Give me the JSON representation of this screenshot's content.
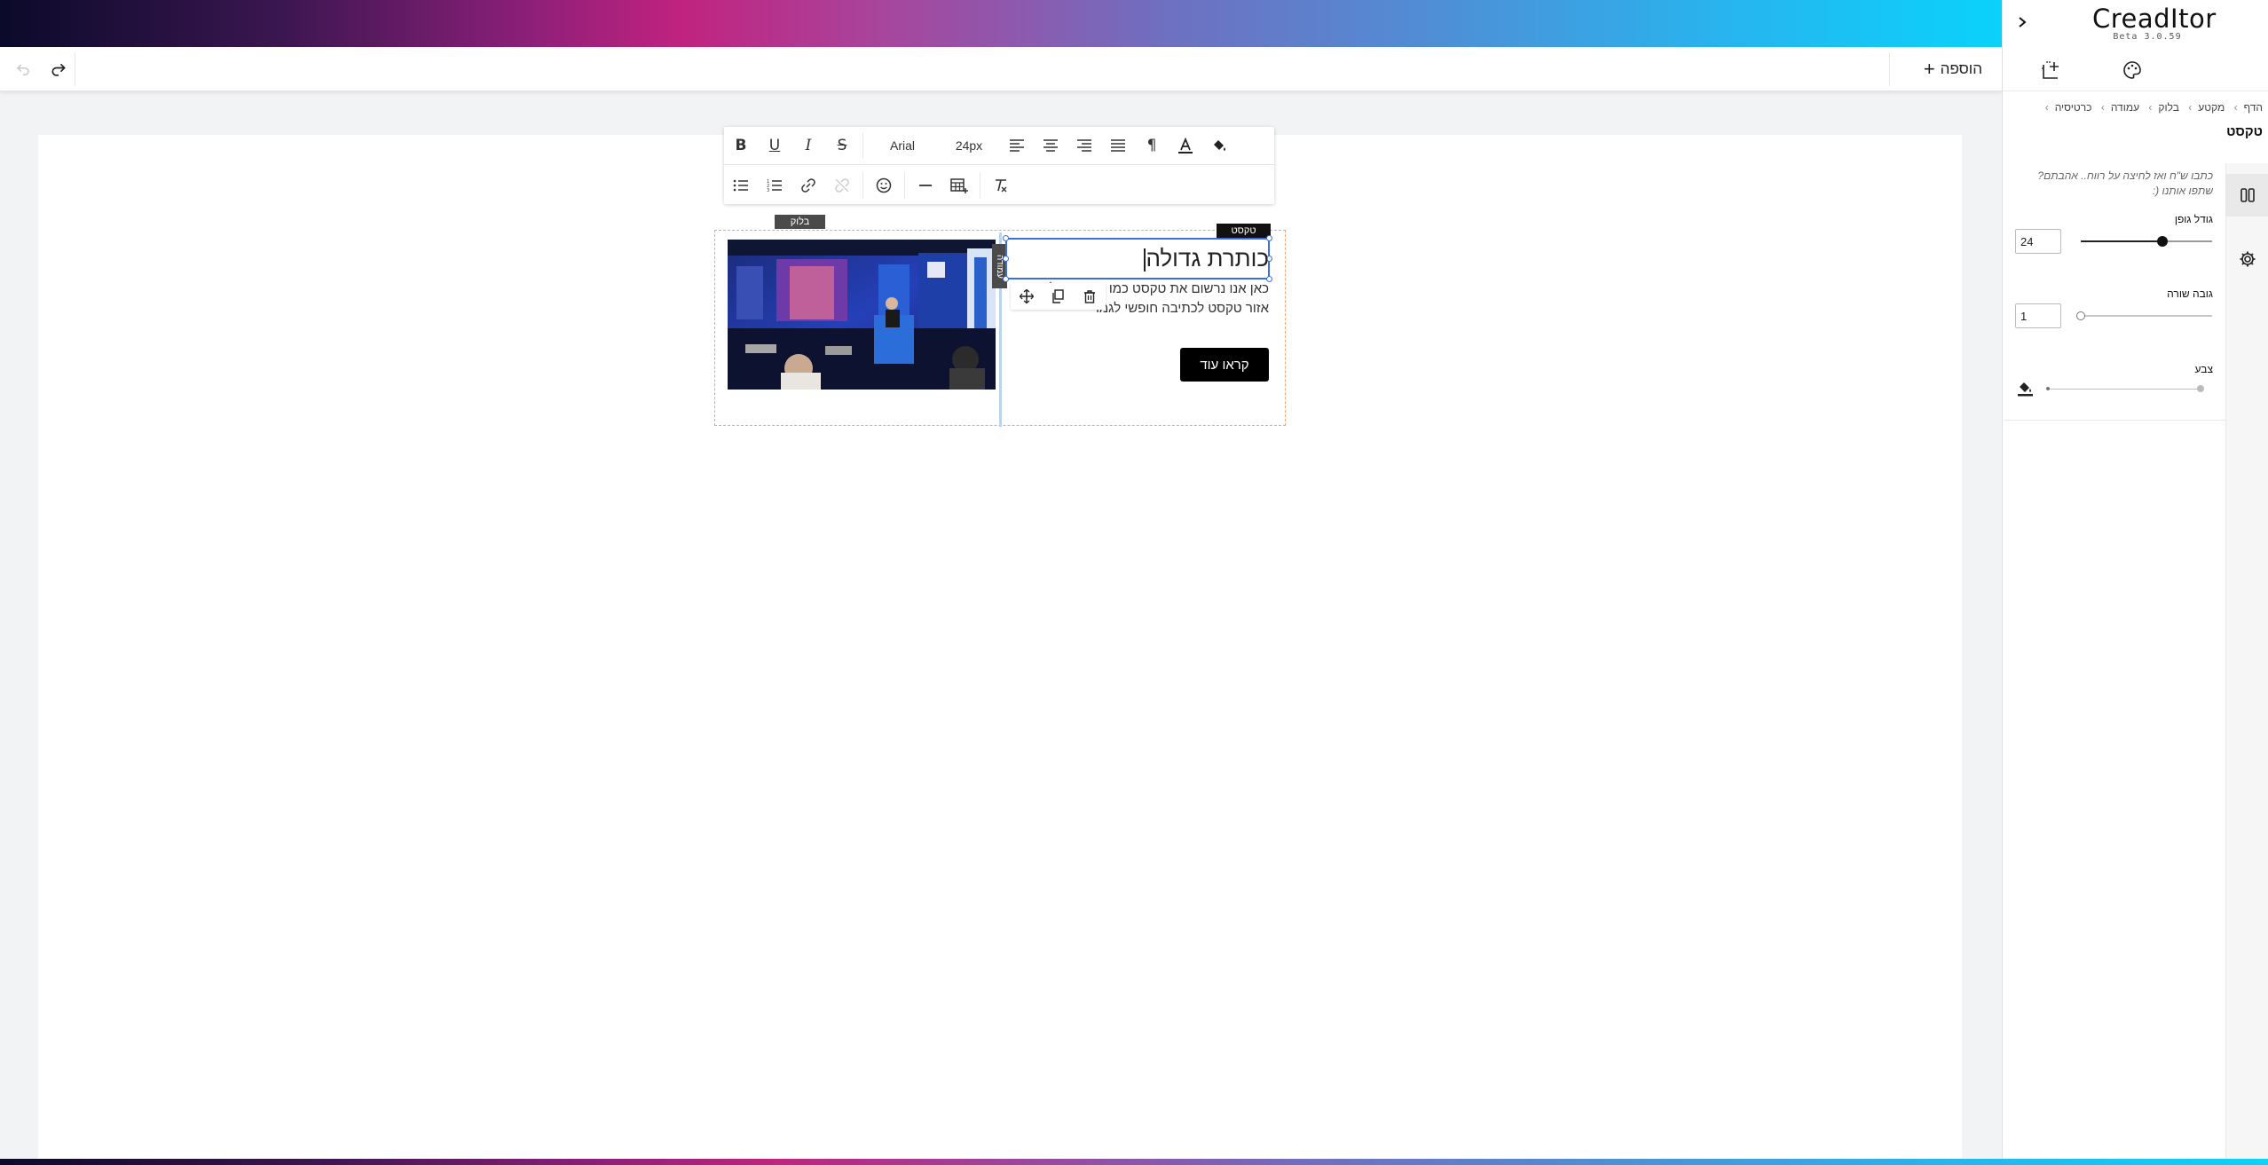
{
  "app": {
    "logo": "CreadItor",
    "version": "Beta 3.0.59"
  },
  "topbar": {
    "add_label": "הוספה"
  },
  "rte_toolbar": {
    "font": "Arial",
    "font_size": "24px"
  },
  "block": {
    "block_tag": "בלוק",
    "column_tag": "עמודה",
    "text_tag": "טקסט",
    "heading": "כותרת גדולה",
    "body": "כאן אנו נרשום את טקסט כמו המוצר שלנו. זהו אזור טקסט לכתיבה חופשי לגמרי",
    "button_label": "קראו עוד"
  },
  "panel": {
    "breadcrumb": [
      "הדף",
      "מקטע",
      "בלוק",
      "עמודה",
      "כרטיסיה"
    ],
    "title": "טקסט",
    "hint": "כתבו ש\"ח ואז לחיצה על רווח.. אהבתם? שתפו אותנו (:",
    "font_size_label": "גודל גופן",
    "font_size_value": "24",
    "font_size_fraction": 0.62,
    "line_height_label": "גובה שורה",
    "line_height_value": "1",
    "line_height_fraction": 0.0,
    "color_label": "צבע"
  },
  "colors": {
    "selection": "#3b6fe0",
    "block_border": "#f5a46e",
    "button_bg": "#000000"
  }
}
